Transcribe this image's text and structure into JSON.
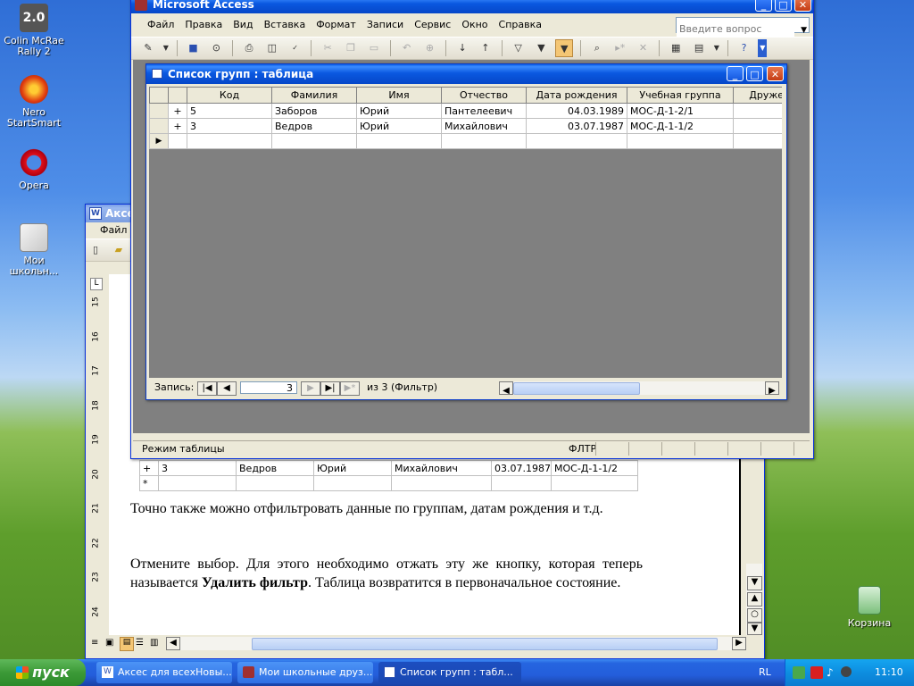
{
  "desktop": {
    "icons": [
      {
        "label": "Colin McRae Rally 2",
        "badge": "2.0"
      },
      {
        "label": "Nero StartSmart"
      },
      {
        "label": "Opera"
      },
      {
        "label": "Мои школьн..."
      },
      {
        "label": "Корзина"
      }
    ]
  },
  "access": {
    "title": "Microsoft Access",
    "menu": [
      "Файл",
      "Правка",
      "Вид",
      "Вставка",
      "Формат",
      "Записи",
      "Сервис",
      "Окно",
      "Справка"
    ],
    "help_placeholder": "Введите вопрос",
    "status_mode": "Режим таблицы",
    "status_filter": "ФЛТР"
  },
  "table_window": {
    "title": "Список групп : таблица",
    "columns": [
      "Код",
      "Фамилия",
      "Имя",
      "Отчество",
      "Дата рождения",
      "Учебная группа",
      "Дружеск"
    ],
    "rows": [
      {
        "expand": "+",
        "code": "5",
        "surname": "Заборов",
        "name": "Юрий",
        "patronymic": "Пантелеевич",
        "birth": "04.03.1989",
        "group": "МОС-Д-1-2/1",
        "extra": ""
      },
      {
        "expand": "+",
        "code": "3",
        "surname": "Ведров",
        "name": "Юрий",
        "patronymic": "Михайлович",
        "birth": "03.07.1987",
        "group": "МОС-Д-1-1/2",
        "extra": ""
      }
    ],
    "nav": {
      "label": "Запись:",
      "current": "3",
      "of_text": "из  3 (Фильтр)"
    }
  },
  "word": {
    "title": "Аксес",
    "menu_file": "Файл",
    "doc_row": {
      "expand": "+",
      "code": "3",
      "surname": "Ведров",
      "name": "Юрий",
      "patronymic": "Михайлович",
      "birth": "03.07.1987",
      "group": "МОС-Д-1-1/2"
    },
    "new_row_marker": "*",
    "paragraph1": "Точно также можно отфильтровать данные по группам, датам рождения и т.д.",
    "paragraph2_before": "Отмените выбор. Для этого необходимо отжать эту же кнопку, которая теперь называется ",
    "paragraph2_bold": "Удалить фильтр",
    "paragraph2_after": ". Таблица возвратится в первоначальное состояние.",
    "ruler": [
      "15",
      "16",
      "17",
      "18",
      "19",
      "20",
      "21",
      "22",
      "23",
      "24"
    ]
  },
  "taskbar": {
    "start": "пуск",
    "tasks": [
      {
        "label": "Аксес для всехНовы..."
      },
      {
        "label": "Мои школьные друз..."
      },
      {
        "label": "Список групп : табл..."
      }
    ],
    "lang": "RL",
    "time": "11:10"
  }
}
